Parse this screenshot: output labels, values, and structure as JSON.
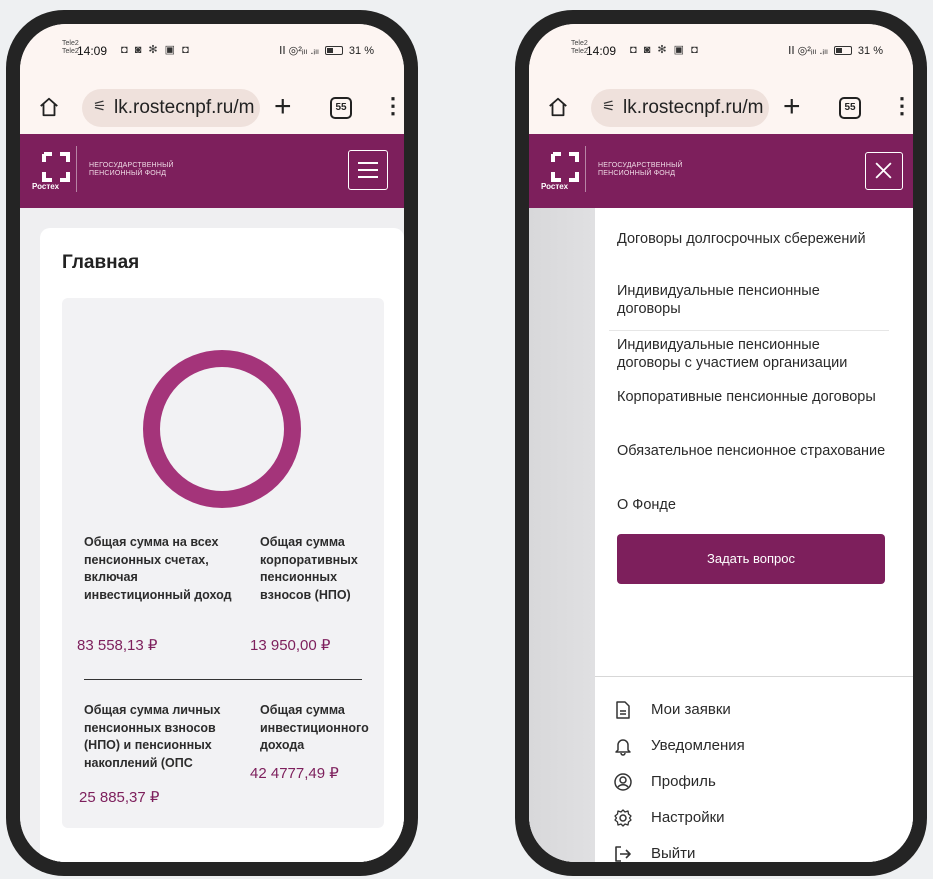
{
  "status_bar": {
    "carrier_1": "Tele2",
    "carrier_2": "Tele2",
    "time": "14:09",
    "icons": "◘ ◙ ✻ ▣ ◘",
    "signal": "ⅠⅠ ◎²ᵢₗₗ .ᵢₗₗ",
    "battery": "31 %"
  },
  "browser": {
    "url": "lk.rostecnpf.ru/m",
    "tabs_count": "55",
    "plus": "+",
    "menu": "⋮"
  },
  "header": {
    "logo_word": "Ростех",
    "fund_line_1": "НЕГОСУДАРСТВЕННЫЙ",
    "fund_line_2": "ПЕНСИОННЫЙ ФОНД"
  },
  "main": {
    "title": "Главная",
    "stats": [
      {
        "label": "Общая сумма на всех пенсионных счетах, включая инвестиционный доход",
        "value": "83 558,13 ₽"
      },
      {
        "label": "Общая сумма корпоративных пенсионных взносов (НПО)",
        "value": "13 950,00 ₽"
      },
      {
        "label": "Общая сумма личных пенсионных взносов (НПО) и пенсионных накоплений (ОПС",
        "value": "25 885,37 ₽"
      },
      {
        "label": "Общая сумма инвестиционного дохода",
        "value": "42 4777,49 ₽"
      }
    ]
  },
  "nav_menu": {
    "items": [
      "Договоры долгосрочных сбережений",
      "Индивидуальные пенсионные договоры",
      "Индивидуальные пенсионные договоры с участием организации",
      "Корпоративные пенсионные договоры",
      "Обязательное пенсионное страхование",
      "О Фонде"
    ],
    "ask_button": "Задать вопрос",
    "bottom": [
      {
        "label": "Мои заявки",
        "icon": "document-icon"
      },
      {
        "label": "Уведомления",
        "icon": "bell-icon"
      },
      {
        "label": "Профиль",
        "icon": "profile-icon"
      },
      {
        "label": "Настройки",
        "icon": "gear-icon"
      },
      {
        "label": "Выйти",
        "icon": "logout-icon"
      }
    ]
  },
  "colors": {
    "brand": "#7d1f5c",
    "donut": "#a4347a",
    "browser_bar": "#fdf5f2"
  }
}
